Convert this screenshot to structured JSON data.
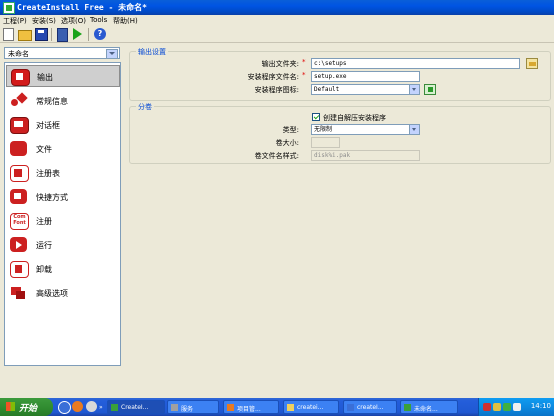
{
  "window": {
    "title": "CreateInstall Free - 未命名*"
  },
  "menu": [
    "工程(P)",
    "安装(S)",
    "选项(O)",
    "Tools",
    "帮助(H)"
  ],
  "toolbar": {
    "icons": [
      "new-icon",
      "open-folder-icon",
      "save-icon",
      "build-icon",
      "run-icon",
      "help-icon"
    ],
    "help_glyph": "?"
  },
  "project_select": {
    "value": "未命名"
  },
  "nav": [
    {
      "label": "输出",
      "icon": "output-icon",
      "active": true
    },
    {
      "label": "常规信息",
      "icon": "general-info-icon"
    },
    {
      "label": "对话框",
      "icon": "dialog-icon"
    },
    {
      "label": "文件",
      "icon": "files-icon"
    },
    {
      "label": "注册表",
      "icon": "registry-icon"
    },
    {
      "label": "快捷方式",
      "icon": "shortcut-icon"
    },
    {
      "label": "注册",
      "icon": "com-font-icon",
      "icon_text": "Com Font"
    },
    {
      "label": "运行",
      "icon": "run-icon"
    },
    {
      "label": "卸载",
      "icon": "uninstall-icon"
    },
    {
      "label": "高级选项",
      "icon": "advanced-options-icon"
    }
  ],
  "output_settings": {
    "group_title": "输出设置",
    "output_folder_label": "输出文件夹:",
    "output_folder_value": "c:\\setups",
    "setup_filename_label": "安装程序文件名:",
    "setup_filename_value": "setup.exe",
    "setup_icon_label": "安装程序图标:",
    "setup_icon_value": "Default",
    "required_mark": "*"
  },
  "volumes": {
    "group_title": "分卷",
    "self_extract_label": "创建自解压安装程序",
    "self_extract_checked": true,
    "type_label": "类型:",
    "type_value": "无限制",
    "volume_size_label": "卷大小:",
    "volume_size_value": "",
    "volume_name_label": "卷文件名样式:",
    "volume_name_value": "disk%i.pak"
  },
  "taskbar": {
    "start_label": "开始",
    "tasks": [
      {
        "label": "CreateI...",
        "active": true
      },
      {
        "label": "服务"
      },
      {
        "label": "项目管..."
      },
      {
        "label": "createi..."
      },
      {
        "label": "createI..."
      },
      {
        "label": "未命名..."
      }
    ],
    "clock": "14:10"
  }
}
